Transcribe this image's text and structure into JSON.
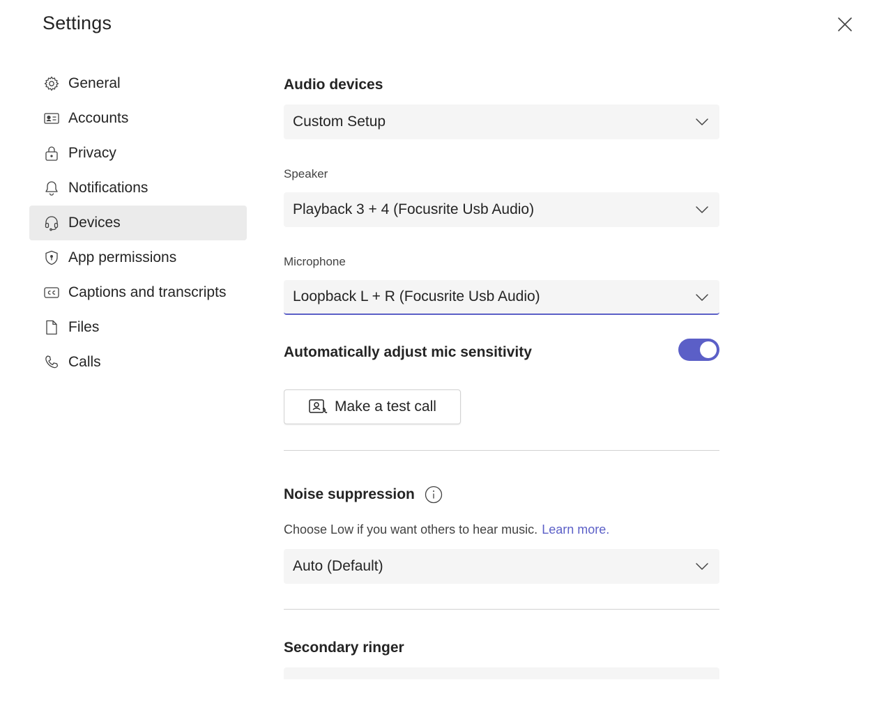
{
  "header": {
    "title": "Settings"
  },
  "sidebar": {
    "items": [
      {
        "label": "General",
        "icon": "gear-icon"
      },
      {
        "label": "Accounts",
        "icon": "id-card-icon"
      },
      {
        "label": "Privacy",
        "icon": "lock-icon"
      },
      {
        "label": "Notifications",
        "icon": "bell-icon"
      },
      {
        "label": "Devices",
        "icon": "headset-icon",
        "active": true
      },
      {
        "label": "App permissions",
        "icon": "shield-icon"
      },
      {
        "label": "Captions and transcripts",
        "icon": "cc-icon"
      },
      {
        "label": "Files",
        "icon": "file-icon"
      },
      {
        "label": "Calls",
        "icon": "phone-icon"
      }
    ]
  },
  "main": {
    "audio_devices": {
      "title": "Audio devices",
      "selected": "Custom Setup"
    },
    "speaker": {
      "label": "Speaker",
      "selected": "Playback 3 + 4 (Focusrite Usb Audio)"
    },
    "microphone": {
      "label": "Microphone",
      "selected": "Loopback L + R (Focusrite Usb Audio)"
    },
    "auto_mic": {
      "label": "Automatically adjust mic sensitivity",
      "enabled": true
    },
    "test_call": {
      "label": "Make a test call"
    },
    "noise": {
      "title": "Noise suppression",
      "helper": "Choose Low if you want others to hear music.",
      "learn_more": "Learn more.",
      "selected": "Auto (Default)"
    },
    "secondary_ringer": {
      "title": "Secondary ringer"
    }
  },
  "colors": {
    "accent": "#5b5fc7",
    "active_nav_bg": "#ebebeb",
    "dropdown_bg": "#f5f5f5",
    "divider": "#d1d1d1"
  }
}
